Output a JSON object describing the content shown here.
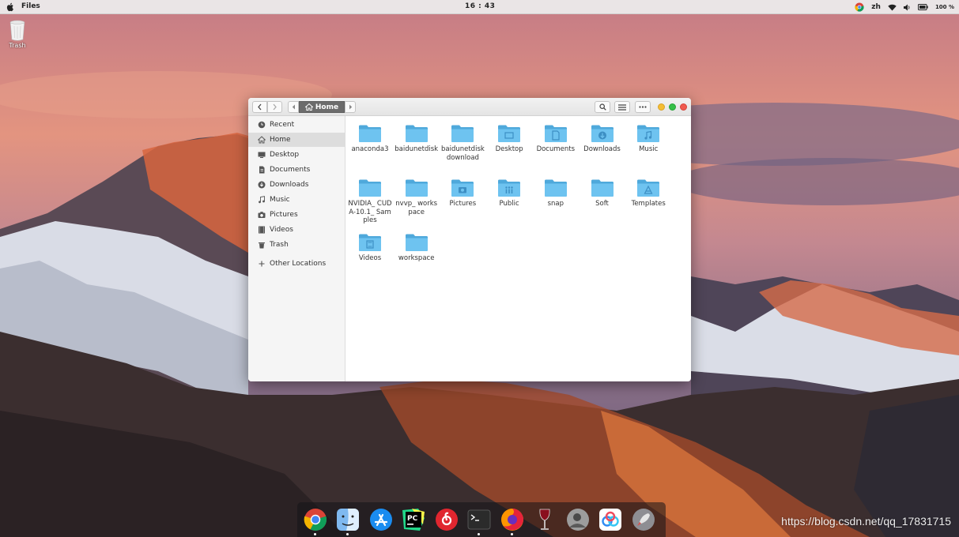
{
  "topbar": {
    "app_name": "Files",
    "clock": "16 : 43",
    "input_method": "zh",
    "battery": "100 %",
    "icons": [
      "apple-icon",
      "chrome-tray-icon",
      "wifi-icon",
      "volume-icon",
      "battery-icon"
    ]
  },
  "desktop": {
    "trash_label": "Trash"
  },
  "window": {
    "path_current": "Home",
    "sidebar": [
      {
        "label": "Recent",
        "icon": "clock-icon"
      },
      {
        "label": "Home",
        "icon": "home-icon",
        "active": true
      },
      {
        "label": "Desktop",
        "icon": "desktop-icon"
      },
      {
        "label": "Documents",
        "icon": "documents-icon"
      },
      {
        "label": "Downloads",
        "icon": "download-icon"
      },
      {
        "label": "Music",
        "icon": "music-icon"
      },
      {
        "label": "Pictures",
        "icon": "camera-icon"
      },
      {
        "label": "Videos",
        "icon": "film-icon"
      },
      {
        "label": "Trash",
        "icon": "trash-icon"
      },
      {
        "label": "Other Locations",
        "icon": "plus-icon"
      }
    ],
    "files": [
      {
        "name": "anaconda3",
        "icon": "folder-icon"
      },
      {
        "name": "baidunetdisk",
        "icon": "folder-icon"
      },
      {
        "name": "baidunetdiskdownload",
        "icon": "folder-icon"
      },
      {
        "name": "Desktop",
        "icon": "folder-desktop-icon"
      },
      {
        "name": "Documents",
        "icon": "folder-documents-icon"
      },
      {
        "name": "Downloads",
        "icon": "folder-downloads-icon"
      },
      {
        "name": "Music",
        "icon": "folder-music-icon"
      },
      {
        "name": "NVIDIA_ CUDA-10.1_ Samples",
        "icon": "folder-icon"
      },
      {
        "name": "nvvp_ workspace",
        "icon": "folder-icon"
      },
      {
        "name": "Pictures",
        "icon": "folder-pictures-icon"
      },
      {
        "name": "Public",
        "icon": "folder-public-icon"
      },
      {
        "name": "snap",
        "icon": "folder-icon"
      },
      {
        "name": "Soft",
        "icon": "folder-icon"
      },
      {
        "name": "Templates",
        "icon": "folder-templates-icon"
      },
      {
        "name": "Videos",
        "icon": "folder-videos-icon"
      },
      {
        "name": "workspace",
        "icon": "folder-icon"
      }
    ],
    "colors": {
      "folder": "#6ec3f0",
      "folder_dark": "#4fa9db",
      "close": "#f05a4f",
      "minimize": "#f5bd34",
      "maximize": "#35c048"
    }
  },
  "dock": {
    "items": [
      "chrome-icon",
      "finder-icon",
      "app-store-icon",
      "pycharm-icon",
      "netease-music-icon",
      "terminal-icon",
      "firefox-icon",
      "wine-icon",
      "avatar-app-icon",
      "baidu-netdisk-icon",
      "launchpad-rocket-icon"
    ]
  },
  "watermark": "https://blog.csdn.net/qq_17831715"
}
